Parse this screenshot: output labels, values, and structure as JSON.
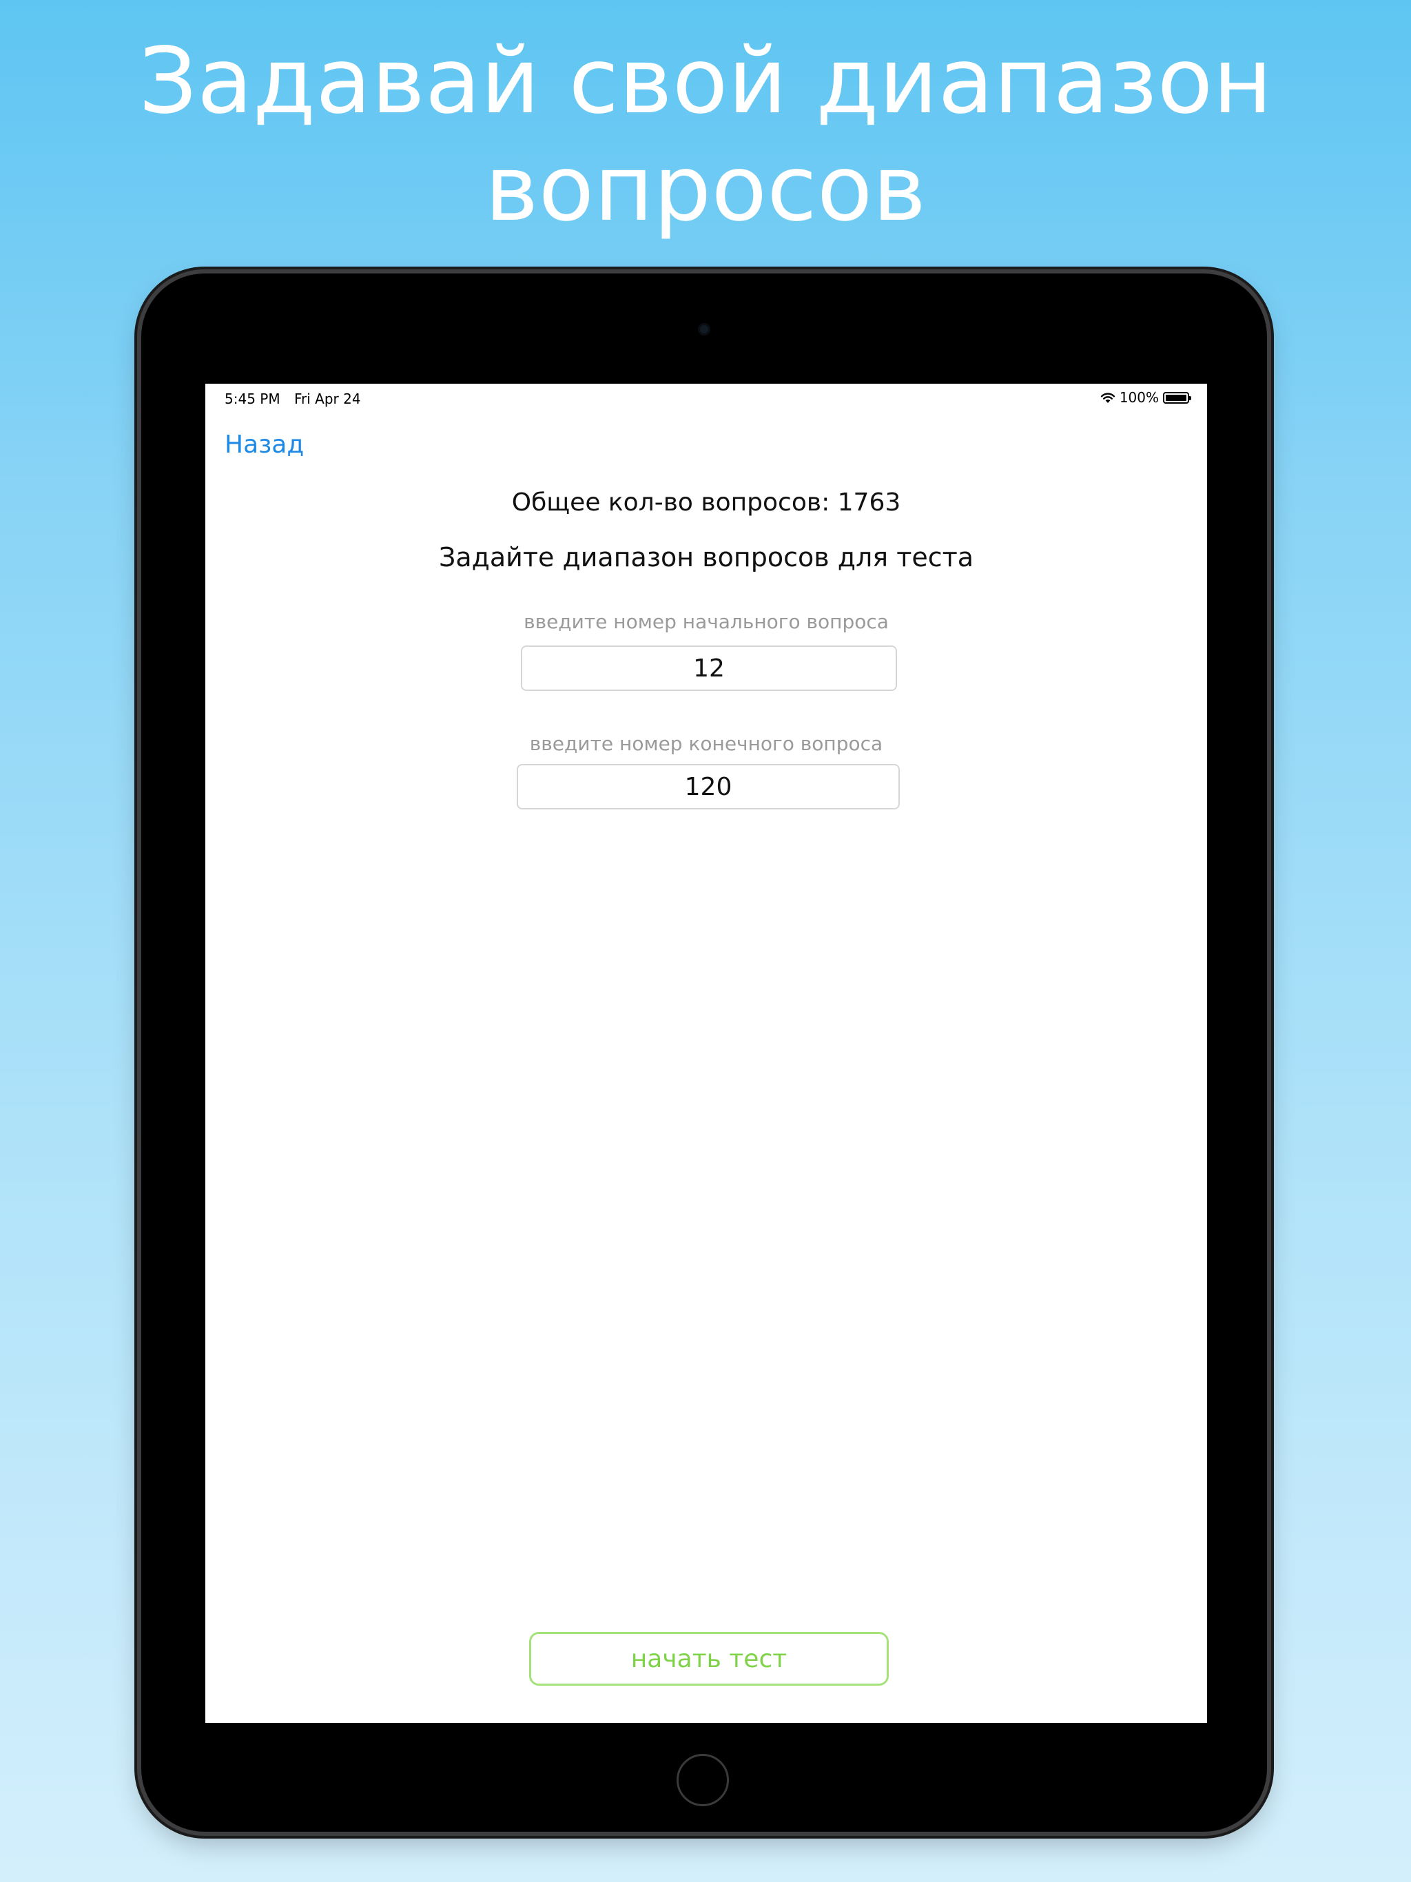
{
  "promo": {
    "headline_line1": "Задавай свой диапазон",
    "headline_line2": "вопросов"
  },
  "status_bar": {
    "time": "5:45 PM",
    "date": "Fri Apr 24",
    "battery_percent": "100%",
    "battery_level": 1.0,
    "icons": [
      "wifi-icon",
      "battery-icon"
    ]
  },
  "nav": {
    "back_label": "Назад"
  },
  "content": {
    "total_questions": "Общее кол-во вопросов: 1763",
    "range_title": "Задайте диапазон вопросов для теста",
    "start_field": {
      "label": "введите номер начального вопроса",
      "value": "12"
    },
    "end_field": {
      "label": "введите номер конечного вопроса",
      "value": "120"
    },
    "start_button_label": "начать тест"
  },
  "colors": {
    "background_top": "#5ec5f2",
    "background_bottom": "#d4effc",
    "link": "#1f8ae6",
    "button_text": "#7ed348",
    "button_border": "#a5e37a",
    "label_gray": "#9a9a9a"
  }
}
